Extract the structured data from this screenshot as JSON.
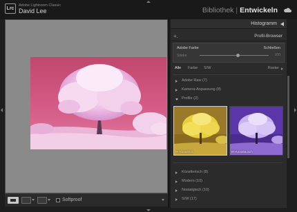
{
  "app": {
    "logo_text": "Lrc",
    "name": "Adobe Lightroom Classic",
    "user": "David Lee"
  },
  "modules": {
    "library": "Bibliothek",
    "separator": "|",
    "develop": "Entwickeln",
    "active": "Entwickeln"
  },
  "icons": {
    "cloud": "cloud-icon",
    "panel_toggle": "triangle-left-icon"
  },
  "right_panel": {
    "histogram_title": "Histogramm",
    "profile_browser": {
      "add": "+.",
      "title": "Profil-Browser",
      "current_profile": "Adobe Farbe",
      "close_label": "Schließen",
      "amount_label": "Stärke",
      "amount_value": "100",
      "amount_fraction": 0.55,
      "filters": [
        "Alle",
        "Farbe",
        "S/W"
      ],
      "active_filter": "Alle",
      "view_label": "Raster",
      "groups_top": [
        {
          "label": "Adobe Raw (7)",
          "open": false
        },
        {
          "label": "Kamera-Anpassung (8)",
          "open": false
        },
        {
          "label": "Profile (2)",
          "open": true
        }
      ],
      "thumbnails": [
        {
          "caption": "IR-Kanaltrick",
          "selected": true
        },
        {
          "caption": "IR-Kanaltausch",
          "selected": false
        }
      ],
      "groups_bottom": [
        {
          "label": "Künstlerisch (8)",
          "open": false
        },
        {
          "label": "Modern (10)",
          "open": false
        },
        {
          "label": "Nostalgisch (10)",
          "open": false
        },
        {
          "label": "S/W (17)",
          "open": false
        }
      ]
    }
  },
  "toolbar": {
    "softproof_label": "Softproof",
    "softproof_checked": false
  },
  "colors": {
    "background": "#1e1e1e",
    "canvas": "#8a8a8a",
    "panel": "#2b2b2b",
    "accent_text": "#e4e4e4"
  }
}
